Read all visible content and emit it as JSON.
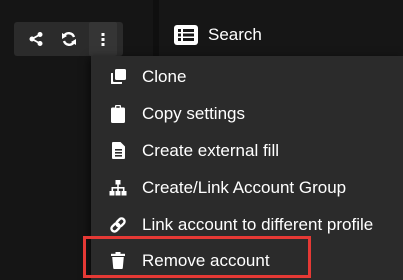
{
  "toolbar": {
    "icons": [
      "share-icon",
      "refresh-icon",
      "more-vertical-icon"
    ]
  },
  "search": {
    "label": "Search",
    "icon": "list-icon"
  },
  "menu": {
    "items": [
      {
        "label": "Clone",
        "icon": "clone-icon"
      },
      {
        "label": "Copy settings",
        "icon": "clipboard-icon"
      },
      {
        "label": "Create external fill",
        "icon": "file-text-icon"
      },
      {
        "label": "Create/Link Account Group",
        "icon": "sitemap-icon"
      },
      {
        "label": "Link account to different profile",
        "icon": "link-icon"
      },
      {
        "label": "Remove account",
        "icon": "trash-icon"
      }
    ]
  },
  "colors": {
    "highlight_border": "#e53935",
    "menu_background": "#2b2b2b",
    "text": "#ffffff"
  }
}
